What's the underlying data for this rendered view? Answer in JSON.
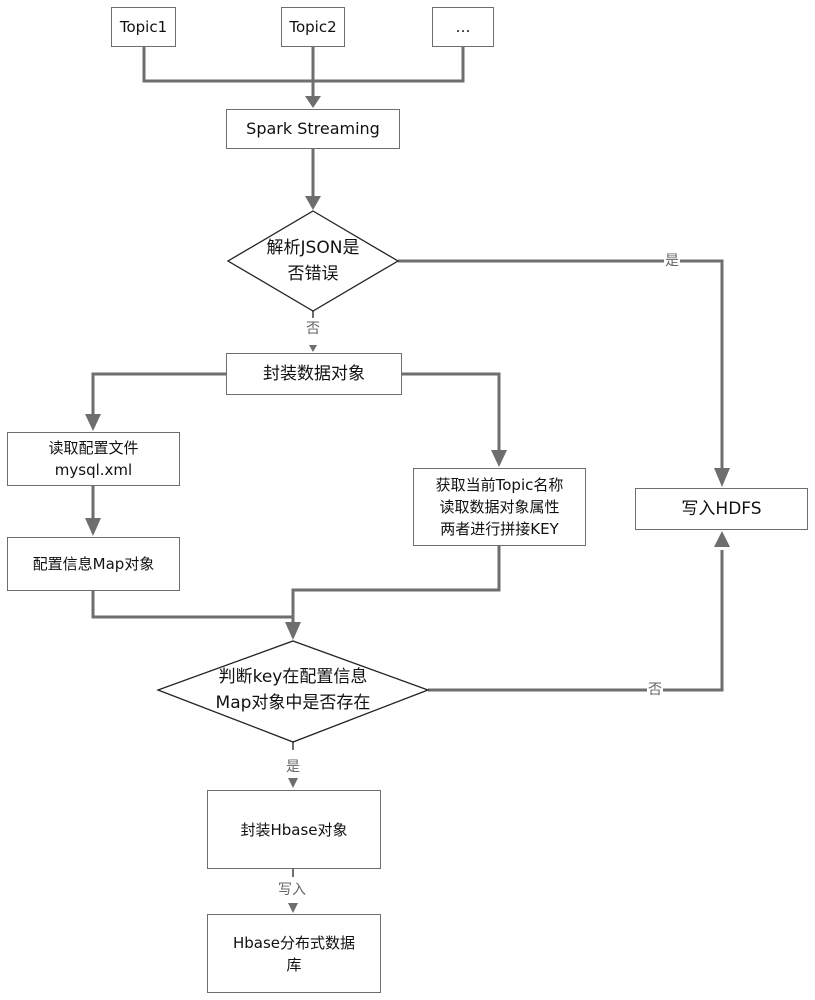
{
  "diagram": {
    "type": "flowchart",
    "nodes": {
      "topic1": "Topic1",
      "topic2": "Topic2",
      "topic_more": "…",
      "spark": "Spark Streaming",
      "parse_json": "解析JSON是\n否错误",
      "wrap_data": "封装数据对象",
      "read_config": "读取配置文件\nmysql.xml",
      "config_map": "配置信息Map对象",
      "get_topic": "获取当前Topic名称\n读取数据对象属性\n两者进行拼接KEY",
      "write_hdfs": "写入HDFS",
      "check_key": "判断key在配置信息\nMap对象中是否存在",
      "wrap_hbase": "封装Hbase对象",
      "hbase_db": "Hbase分布式数据\n库"
    },
    "edge_labels": {
      "json_yes": "是",
      "json_no": "否",
      "key_no": "否",
      "key_yes": "是",
      "write": "写入"
    },
    "colors": {
      "line": "#6e6e6e",
      "label": "#666666"
    }
  }
}
